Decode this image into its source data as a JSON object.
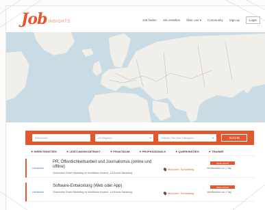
{
  "brand": {
    "logo": "Job",
    "subtitle": "INSIGHTS"
  },
  "nav": {
    "items": [
      "Job finden",
      "Job erstellen",
      "Über uns ▾",
      "Community",
      "Sign up"
    ],
    "login": "Login"
  },
  "search": {
    "keyword_placeholder": "Stichworte",
    "region_value": "All Regions",
    "category_placeholder": "Wählen Sie eine Kategorie...",
    "button": "SUCHE"
  },
  "filters": [
    "✦ DIREKTEINSTIEG",
    "✦ LEISTUNGSKONTRAKT",
    "✦ PRAKTIKUM",
    "✦ PROFESSIONALS",
    "✦ QUEREINSTIEG",
    "✦ TRAINEE"
  ],
  "jobs": [
    {
      "logo": "chemistree",
      "title": "PR, Öffentlichkeitsarbeit und Journalismus (online und offline)",
      "company": "Chemistree GmbH Marketing im beruflichen Kontext, J.& Events Marketing",
      "location": "München, Schwabing",
      "type": "PRAKTIKUM",
      "date": "Veröffentlicht vor 1 Tag"
    },
    {
      "logo": "chemistree",
      "title": "Software-Entwicklung (Web oder App)",
      "company": "Chemistree GmbH Marketing im beruflichen Kontext, J.& Events Marketing",
      "location": "München, Schwabing",
      "type": "PRAKTIKUM",
      "date": "Veröffentlicht vor 1 Tag"
    }
  ],
  "colors": {
    "accent": "#e4572e",
    "map_water": "#c9dbe4",
    "map_land": "#f1efe9"
  }
}
